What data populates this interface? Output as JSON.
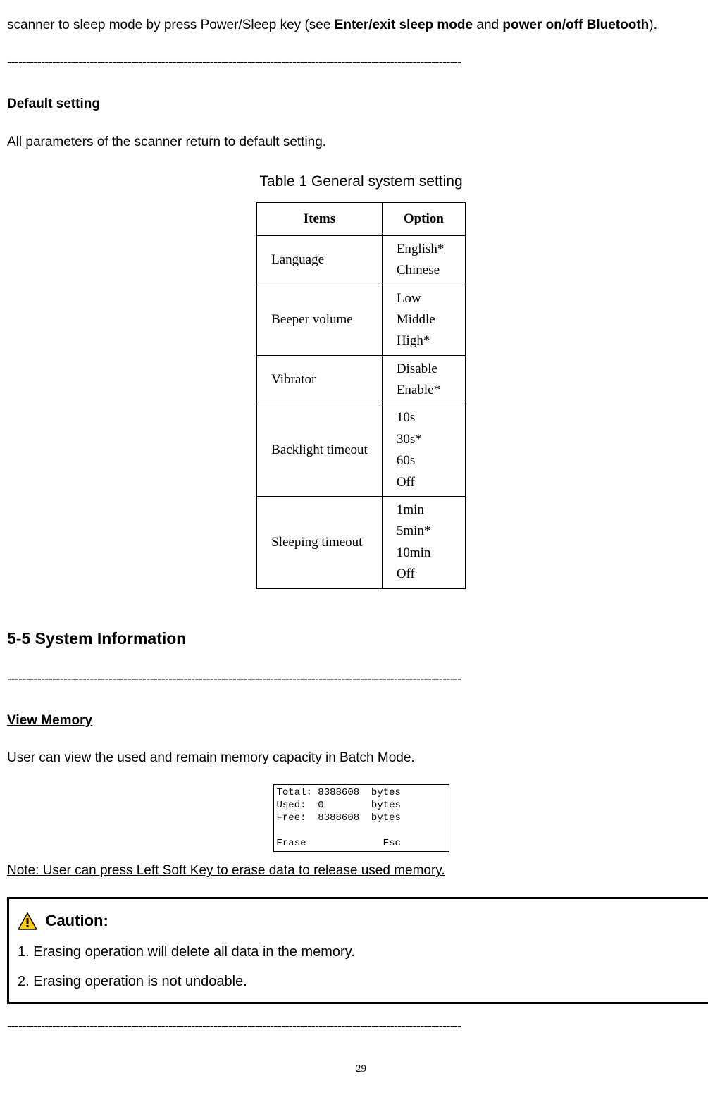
{
  "intro": {
    "line1_prefix": "scanner to sleep mode by press Power/Sleep key (see ",
    "bold1": "Enter/exit sleep mode",
    "mid": " and ",
    "bold2": "power on/off Bluetooth",
    "suffix": ")."
  },
  "separator": "-------------------------------------------------------------------------------------------------------------------------",
  "default_setting": {
    "heading": "Default setting",
    "desc": "All parameters of the scanner return to default setting."
  },
  "table": {
    "caption": "Table 1 General system setting",
    "header_items": "Items",
    "header_option": "Option",
    "rows": [
      {
        "item": "Language",
        "options": [
          "English*",
          "Chinese"
        ]
      },
      {
        "item": "Beeper volume",
        "options": [
          "Low",
          "Middle",
          "High*"
        ]
      },
      {
        "item": "Vibrator",
        "options": [
          "Disable",
          "Enable*"
        ]
      },
      {
        "item": "Backlight timeout",
        "options": [
          "10s",
          "30s*",
          "60s",
          "Off"
        ]
      },
      {
        "item": "Sleeping timeout",
        "options": [
          "1min",
          "5min*",
          "10min",
          "Off"
        ]
      }
    ]
  },
  "section_5_5": {
    "heading": "5-5 System Information"
  },
  "view_memory": {
    "heading": "View Memory",
    "desc": "User can view the used and remain memory capacity in Batch Mode.",
    "display_line1": "Total: 8388608  bytes",
    "display_line2": "Used:  0        bytes",
    "display_line3": "Free:  8388608  bytes",
    "display_blank": " ",
    "display_line4": "Erase             Esc",
    "note": "Note: User can press Left Soft Key to erase data to release used memory."
  },
  "caution": {
    "title": "Caution:",
    "item1": "1. Erasing operation will delete all data in the memory.",
    "item2": "2. Erasing operation is not undoable."
  },
  "page_number": "29"
}
